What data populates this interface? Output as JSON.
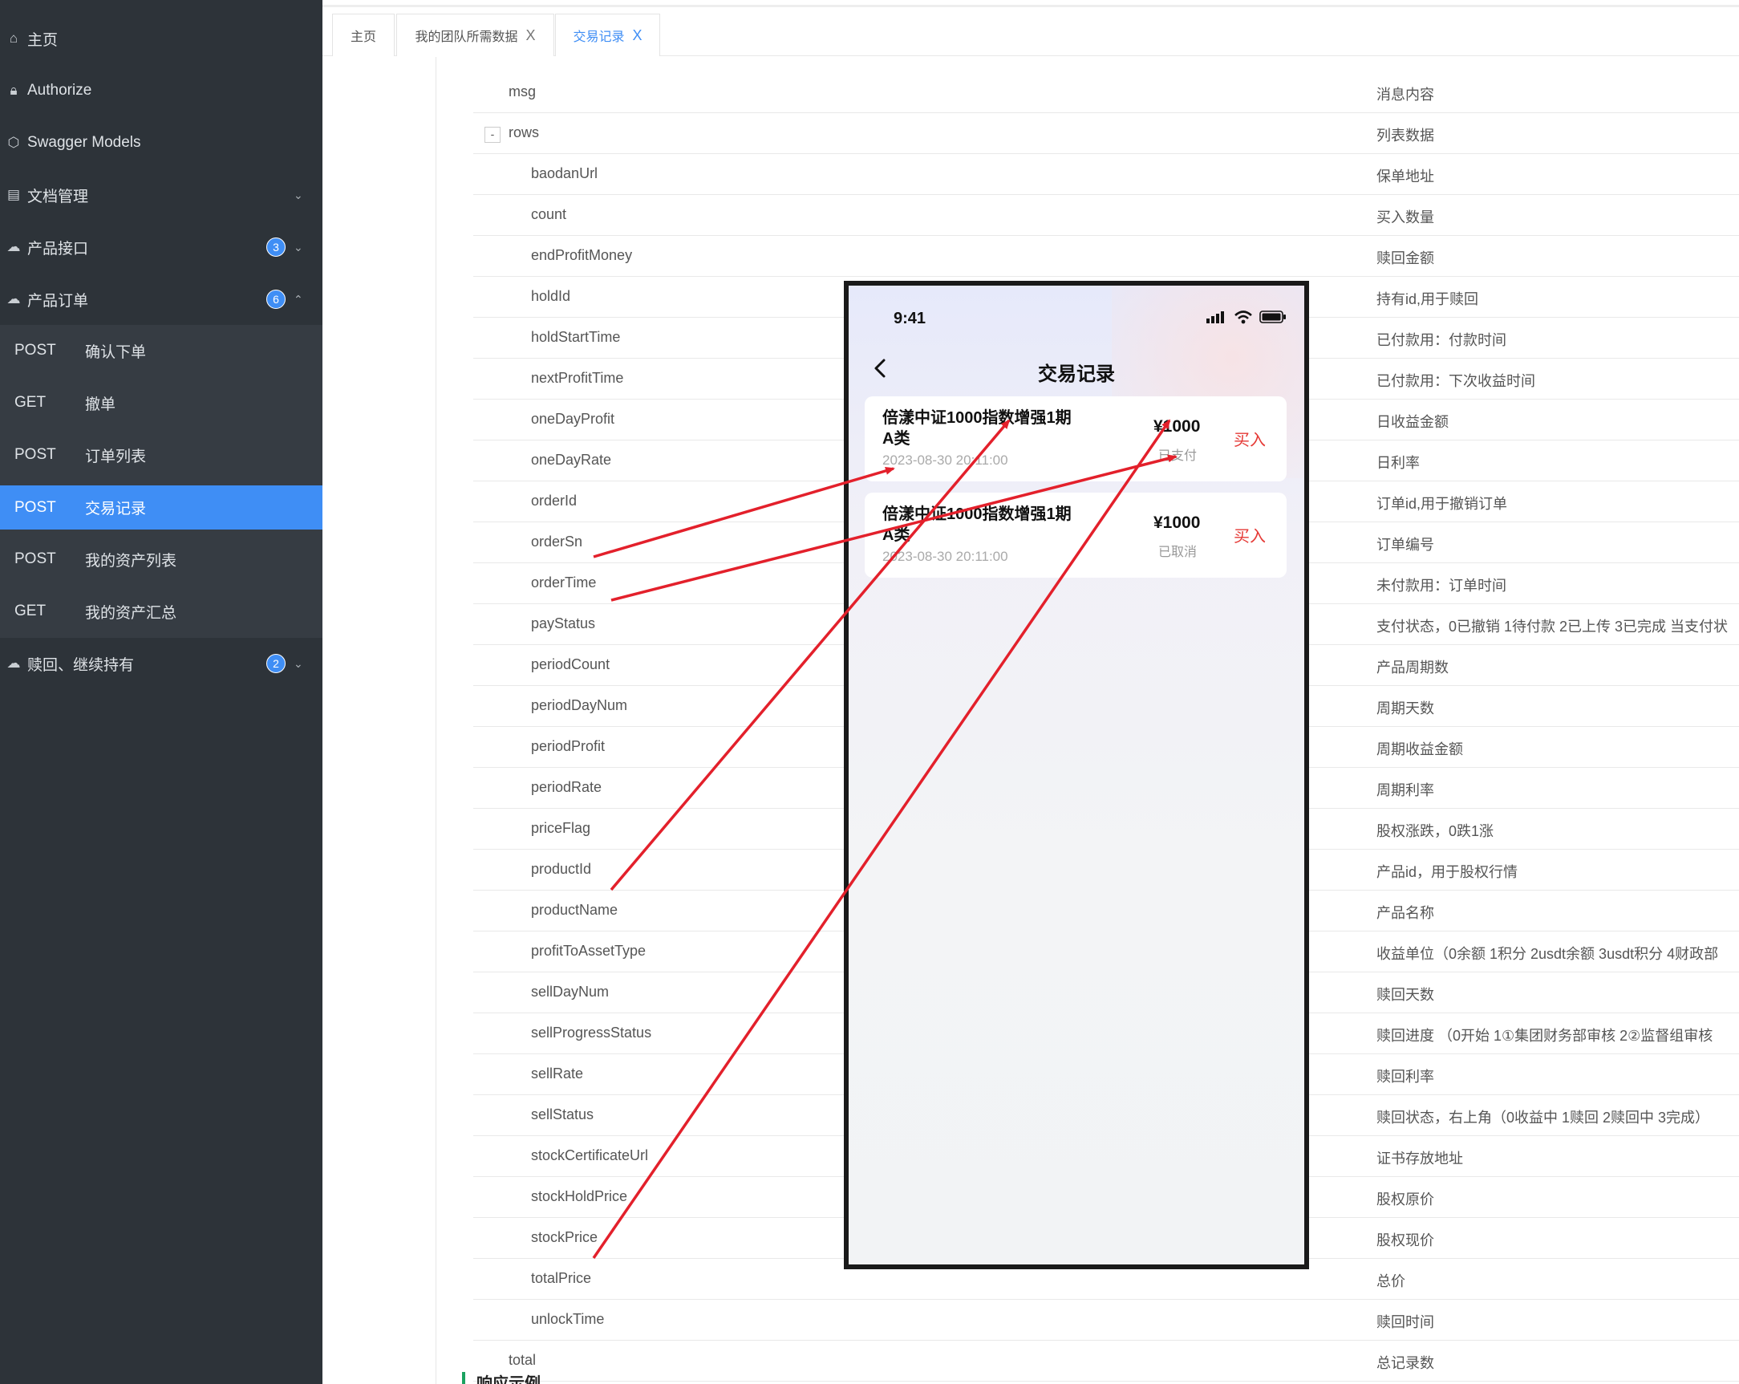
{
  "sidebar": {
    "items": [
      {
        "icon": "home-icon",
        "label": "主页",
        "badge": "",
        "chevron": ""
      },
      {
        "icon": "lock-icon",
        "label": "Authorize",
        "badge": "",
        "chevron": ""
      },
      {
        "icon": "cube-icon",
        "label": "Swagger Models",
        "badge": "",
        "chevron": ""
      },
      {
        "icon": "doc-settings-icon",
        "label": "文档管理",
        "badge": "",
        "chevron": "⌄"
      },
      {
        "icon": "cloud-icon",
        "label": "产品接口",
        "badge": "3",
        "chevron": "⌄"
      },
      {
        "icon": "cloud-icon",
        "label": "产品订单",
        "badge": "6",
        "chevron": "⌃"
      },
      {
        "icon": "cloud-icon",
        "label": "赎回、继续持有",
        "badge": "2",
        "chevron": "⌄"
      }
    ],
    "sub_items": [
      {
        "method": "POST",
        "label": "确认下单"
      },
      {
        "method": "GET",
        "label": "撤单"
      },
      {
        "method": "POST",
        "label": "订单列表"
      },
      {
        "method": "POST",
        "label": "交易记录"
      },
      {
        "method": "POST",
        "label": "我的资产列表"
      },
      {
        "method": "GET",
        "label": "我的资产汇总"
      }
    ]
  },
  "tabs": [
    {
      "label": "主页"
    },
    {
      "label": "我的团队所需数据",
      "close": "X"
    },
    {
      "label": "交易记录",
      "close": "X"
    }
  ],
  "fields": [
    {
      "name": "msg",
      "desc": "消息内容"
    },
    {
      "name": "rows",
      "desc": "列表数据",
      "toggle": "-"
    },
    {
      "name": "baodanUrl",
      "desc": "保单地址"
    },
    {
      "name": "count",
      "desc": "买入数量"
    },
    {
      "name": "endProfitMoney",
      "desc": "赎回金额"
    },
    {
      "name": "holdId",
      "desc": "持有id,用于赎回"
    },
    {
      "name": "holdStartTime",
      "desc": "已付款用：付款时间"
    },
    {
      "name": "nextProfitTime",
      "desc": "已付款用：下次收益时间"
    },
    {
      "name": "oneDayProfit",
      "desc": "日收益金额"
    },
    {
      "name": "oneDayRate",
      "desc": "日利率"
    },
    {
      "name": "orderId",
      "desc": "订单id,用于撤销订单"
    },
    {
      "name": "orderSn",
      "desc": "订单编号"
    },
    {
      "name": "orderTime",
      "desc": "未付款用：订单时间"
    },
    {
      "name": "payStatus",
      "desc": "支付状态，0已撤销 1待付款 2已上传 3已完成 当支付状"
    },
    {
      "name": "periodCount",
      "desc": "产品周期数"
    },
    {
      "name": "periodDayNum",
      "desc": "周期天数"
    },
    {
      "name": "periodProfit",
      "desc": "周期收益金额"
    },
    {
      "name": "periodRate",
      "desc": "周期利率"
    },
    {
      "name": "priceFlag",
      "desc": "股权涨跌，0跌1涨"
    },
    {
      "name": "productId",
      "desc": "产品id，用于股权行情"
    },
    {
      "name": "productName",
      "desc": "产品名称"
    },
    {
      "name": "profitToAssetType",
      "desc": "收益单位（0余额 1积分 2usdt余额 3usdt积分 4财政部"
    },
    {
      "name": "sellDayNum",
      "desc": "赎回天数"
    },
    {
      "name": "sellProgressStatus",
      "desc": "赎回进度 （0开始 1①集团财务部审核 2②监督组审核"
    },
    {
      "name": "sellRate",
      "desc": "赎回利率"
    },
    {
      "name": "sellStatus",
      "desc": "赎回状态，右上角（0收益中 1赎回 2赎回中 3完成）"
    },
    {
      "name": "stockCertificateUrl",
      "desc": "证书存放地址"
    },
    {
      "name": "stockHoldPrice",
      "desc": "股权原价"
    },
    {
      "name": "stockPrice",
      "desc": "股权现价"
    },
    {
      "name": "totalPrice",
      "desc": "总价"
    },
    {
      "name": "unlockTime",
      "desc": "赎回时间"
    },
    {
      "name": "total",
      "desc": "总记录数"
    }
  ],
  "section_title": "响应示例",
  "phone": {
    "time": "9:41",
    "title": "交易记录",
    "cards": [
      {
        "name": "倍漾中证1000指数增强1期A类",
        "time": "2023-08-30 20:11:00",
        "amount": "¥1000",
        "status": "已支付",
        "action": "买入"
      },
      {
        "name": "倍漾中证1000指数增强1期A类",
        "time": "2023-08-30 20:11:00",
        "amount": "¥1000",
        "status": "已取消",
        "action": "买入"
      }
    ]
  },
  "colors": {
    "sidebar_bg": "#2d3339",
    "active": "#3f8ef5",
    "arrow": "#e3202b",
    "buy": "#e53935"
  }
}
